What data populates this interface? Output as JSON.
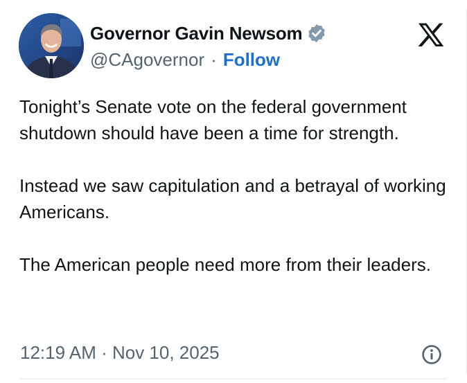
{
  "author": {
    "name": "Governor Gavin Newsom",
    "handle": "@CAgovernor",
    "separator": "·",
    "follow_label": "Follow",
    "verified_badge_color": "#829aab",
    "follow_color": "#1d6fd1"
  },
  "post": {
    "paragraphs": [
      "Tonight’s Senate vote on the federal government shutdown should have been a time for strength.",
      "Instead we saw capitulation and a betrayal of working Americans.",
      "The American people need more from their leaders."
    ],
    "timestamp": "12:19 AM · Nov 10, 2025"
  },
  "icons": {
    "platform_logo": "x-logo-icon",
    "verified": "verified-badge-icon",
    "info": "info-icon"
  }
}
